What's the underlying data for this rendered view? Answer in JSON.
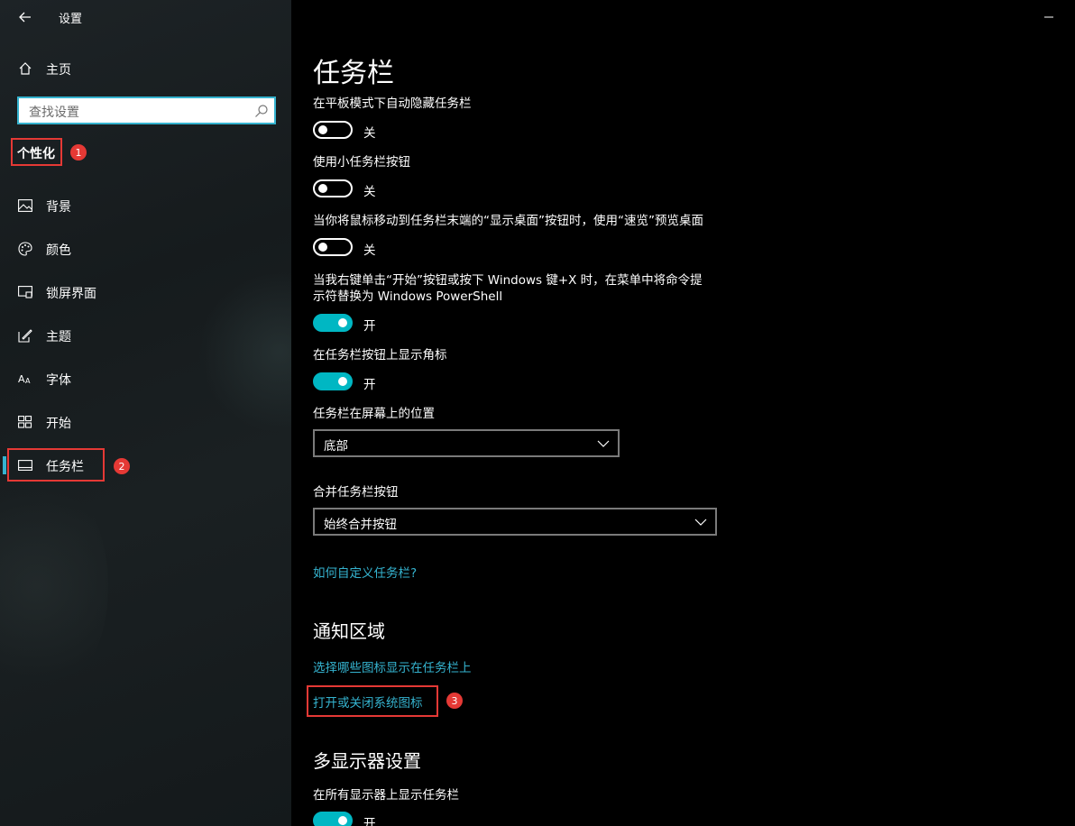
{
  "app": {
    "title": "设置"
  },
  "sidebar": {
    "home_label": "主页",
    "search_placeholder": "查找设置",
    "section_label": "个性化",
    "items": [
      {
        "label": "背景",
        "icon": "picture-icon"
      },
      {
        "label": "颜色",
        "icon": "palette-icon"
      },
      {
        "label": "锁屏界面",
        "icon": "lock-screen-icon"
      },
      {
        "label": "主题",
        "icon": "theme-brush-icon"
      },
      {
        "label": "字体",
        "icon": "font-icon"
      },
      {
        "label": "开始",
        "icon": "start-grid-icon"
      },
      {
        "label": "任务栏",
        "icon": "taskbar-icon",
        "selected": true
      }
    ]
  },
  "annotations": {
    "badge1": "1",
    "badge2": "2",
    "badge3": "3",
    "color": "#e53935"
  },
  "main": {
    "title": "任务栏",
    "settings": [
      {
        "label": "在平板模式下自动隐藏任务栏",
        "state": "关",
        "on": false
      },
      {
        "label": "使用小任务栏按钮",
        "state": "关",
        "on": false
      },
      {
        "label": "当你将鼠标移动到任务栏末端的“显示桌面”按钮时，使用“速览”预览桌面",
        "state": "关",
        "on": false
      },
      {
        "label_line1": "当我右键单击“开始”按钮或按下 Windows 键+X 时，在菜单中将命令提",
        "label_line2": "示符替换为 Windows PowerShell",
        "state": "开",
        "on": true
      },
      {
        "label": "在任务栏按钮上显示角标",
        "state": "开",
        "on": true
      }
    ],
    "position_label": "任务栏在屏幕上的位置",
    "position_value": "底部",
    "combine_label": "合并任务栏按钮",
    "combine_value": "始终合并按钮",
    "help_link": "如何自定义任务栏?",
    "notification_title": "通知区域",
    "notification_link1": "选择哪些图标显示在任务栏上",
    "notification_link2": "打开或关闭系统图标",
    "multi_display_title": "多显示器设置",
    "multi_display_label": "在所有显示器上显示任务栏",
    "multi_display_state": "开"
  },
  "colors": {
    "accent": "#00b7c3",
    "link": "#35b3cf",
    "search_border": "#35b3cf"
  }
}
